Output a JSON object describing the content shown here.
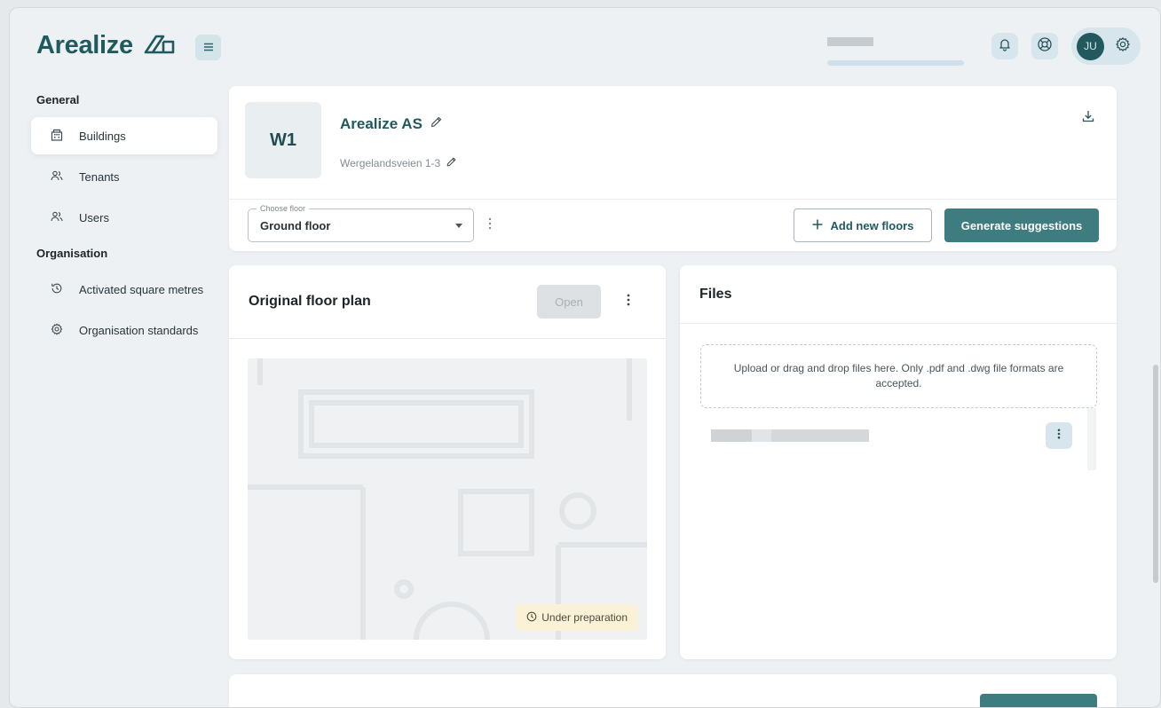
{
  "app": {
    "logo_text": "Arealize",
    "colors": {
      "brand": "#21595e",
      "accent": "#3e7c80",
      "badge": "#fbf1d7"
    }
  },
  "topbar": {
    "user_initials": "JU",
    "icons": [
      "menu-icon",
      "bell-icon",
      "lifebuoy-icon",
      "gear-icon"
    ]
  },
  "sidebar": {
    "general_title": "General",
    "general_items": [
      {
        "label": "Buildings",
        "icon": "building-icon",
        "active": true
      },
      {
        "label": "Tenants",
        "icon": "people-icon"
      },
      {
        "label": "Users",
        "icon": "people-icon"
      }
    ],
    "organisation_title": "Organisation",
    "organisation_items": [
      {
        "label": "Activated square metres",
        "icon": "history-icon"
      },
      {
        "label": "Organisation standards",
        "icon": "cog-icon"
      }
    ]
  },
  "building": {
    "code": "W1",
    "name": "Arealize AS",
    "address": "Wergelandsveien 1-3",
    "floor_label": "Choose floor",
    "floor_value": "Ground floor",
    "add_floors_label": "Add new floors",
    "generate_label": "Generate suggestions"
  },
  "floor_plan": {
    "title": "Original floor plan",
    "open_label": "Open",
    "status_label": "Under preparation"
  },
  "files": {
    "title": "Files",
    "dropzone_text": "Upload or drag and drop files here. Only .pdf and .dwg file formats are accepted."
  }
}
